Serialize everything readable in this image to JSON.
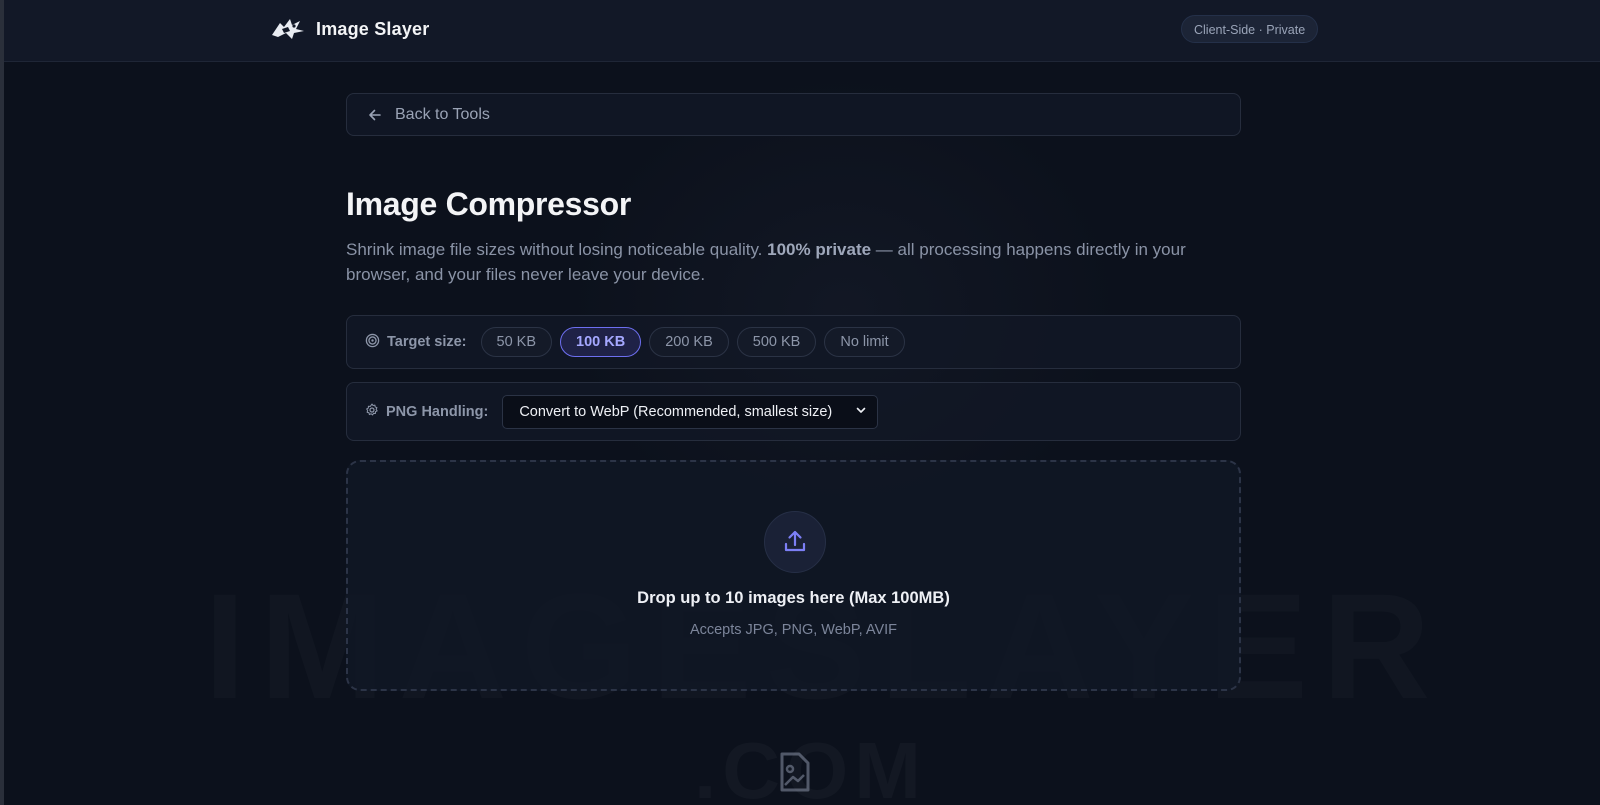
{
  "header": {
    "brand_name": "Image Slayer",
    "badge": "Client-Side · Private"
  },
  "nav": {
    "back_label": "Back to Tools"
  },
  "page": {
    "title": "Image Compressor",
    "subtitle_pre": "Shrink image file sizes without losing noticeable quality. ",
    "subtitle_bold": "100% private",
    "subtitle_post": " — all processing happens directly in your browser, and your files never leave your device."
  },
  "target_size": {
    "label": "Target size:",
    "options": [
      "50 KB",
      "100 KB",
      "200 KB",
      "500 KB",
      "No limit"
    ],
    "selected": "100 KB"
  },
  "png_handling": {
    "label": "PNG Handling:",
    "selected_option": "Convert to WebP (Recommended, smallest size)"
  },
  "dropzone": {
    "title": "Drop up to 10 images here (Max 100MB)",
    "accepts": "Accepts JPG, PNG, WebP, AVIF"
  },
  "watermark": {
    "text": "IMAGESLAYER",
    "suffix": ".COM"
  },
  "colors": {
    "accent": "#6d6ff0",
    "background": "#0c111c",
    "header": "#121827"
  },
  "icons": {
    "brand": "slayer-logo-icon",
    "back": "arrow-left-icon",
    "target": "target-icon",
    "png": "gear-icon",
    "select": "chevron-down-icon",
    "upload": "upload-icon",
    "bottom": "image-file-icon"
  }
}
